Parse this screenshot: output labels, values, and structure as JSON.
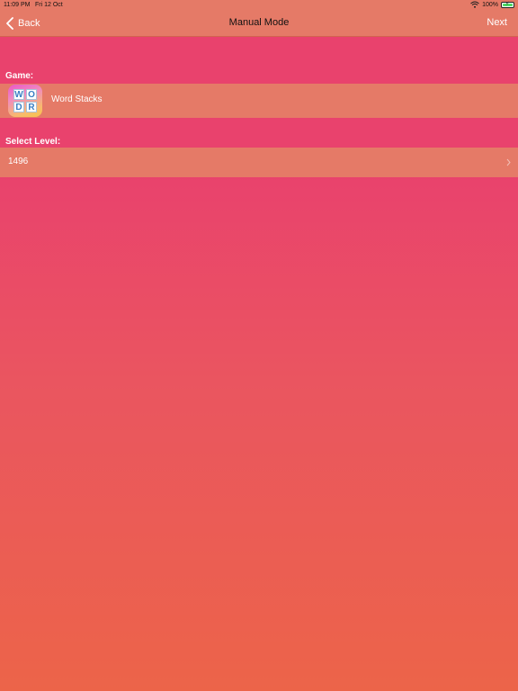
{
  "status_bar": {
    "time": "11:09 PM",
    "date": "Fri 12 Oct",
    "battery": "100%",
    "battery_level": 100,
    "icons": [
      "wifi-icon",
      "battery-icon"
    ]
  },
  "nav": {
    "back_label": "Back",
    "title": "Manual Mode",
    "next_label": "Next"
  },
  "game_section": {
    "label": "Game:",
    "game_name": "Word Stacks",
    "icon_tiles": [
      "W",
      "O",
      "D",
      "R"
    ]
  },
  "level_section": {
    "label": "Select Level:",
    "value": "1496"
  },
  "colors": {
    "row_background": "#e57a67",
    "background_top": "#e9426d",
    "background_bottom": "#ec6449"
  }
}
